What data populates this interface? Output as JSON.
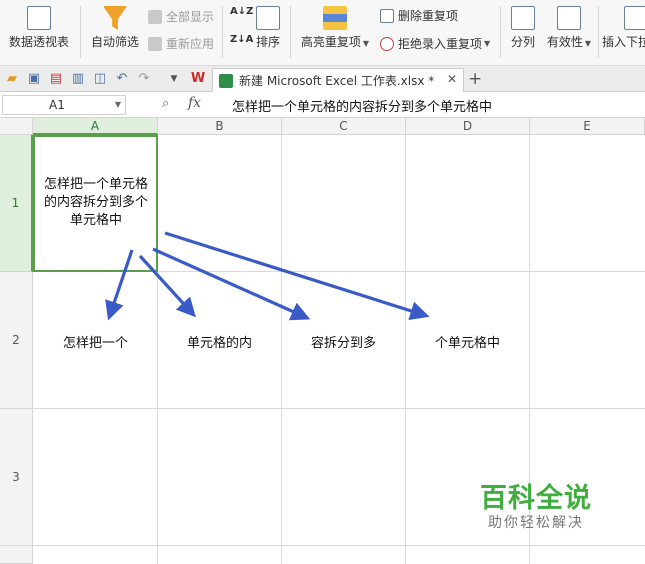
{
  "ribbon": {
    "pivot_table": "数据透视表",
    "auto_filter": "自动筛选",
    "show_all": "全部显示",
    "reapply": "重新应用",
    "sort": "排序",
    "highlight_dup": "高亮重复项",
    "delete_dup": "删除重复项",
    "reject_dup": "拒绝录入重复项",
    "split_column": "分列",
    "validity": "有效性",
    "insert_dropdown": "插入下拉"
  },
  "tabs": {
    "doc_title": "新建 Microsoft Excel 工作表.xlsx *"
  },
  "formula_bar": {
    "name_box": "A1",
    "fx": "fx",
    "content": "怎样把一个单元格的内容拆分到多个单元格中"
  },
  "grid": {
    "columns": [
      "A",
      "B",
      "C",
      "D",
      "E"
    ],
    "rows": [
      "1",
      "2",
      "3"
    ],
    "a1": "怎样把一个单元格的内容拆分到多个单元格中",
    "a2": "怎样把一个",
    "b2": "单元格的内",
    "c2": "容拆分到多",
    "d2": "个单元格中"
  },
  "watermark": {
    "brand": "百科全说",
    "slogan": "助你轻松解决"
  },
  "colors": {
    "accent_green": "#5a9e4c",
    "arrow_blue": "#3a5bc7",
    "watermark_green": "#3fae3f"
  }
}
